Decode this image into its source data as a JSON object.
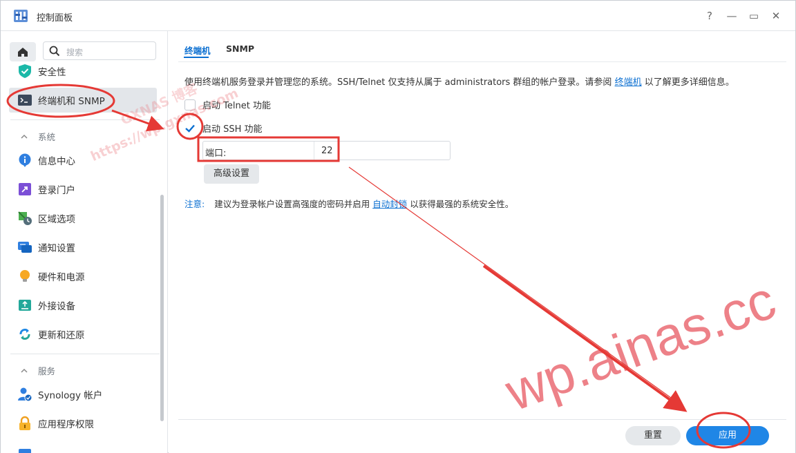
{
  "window": {
    "title": "控制面板",
    "help_glyph": "?",
    "minimize_glyph": "—",
    "maximize_glyph": "▭",
    "close_glyph": "✕"
  },
  "sidebar": {
    "search_placeholder": "搜索",
    "items_top": [
      {
        "label": "安全性",
        "icon": "shield-check-icon"
      },
      {
        "label": "终端机和 SNMP",
        "icon": "terminal-icon",
        "active": true
      }
    ],
    "section_system": "系统",
    "items_system": [
      {
        "label": "信息中心",
        "icon": "info-icon"
      },
      {
        "label": "登录门户",
        "icon": "login-portal-icon"
      },
      {
        "label": "区域选项",
        "icon": "region-options-icon"
      },
      {
        "label": "通知设置",
        "icon": "notification-icon"
      },
      {
        "label": "硬件和电源",
        "icon": "bulb-icon"
      },
      {
        "label": "外接设备",
        "icon": "external-device-icon"
      },
      {
        "label": "更新和还原",
        "icon": "update-restore-icon"
      }
    ],
    "section_services": "服务",
    "items_services": [
      {
        "label": "Synology 帐户",
        "icon": "synology-account-icon"
      },
      {
        "label": "应用程序权限",
        "icon": "lock-icon"
      }
    ]
  },
  "content": {
    "tabs": [
      {
        "label": "终端机",
        "active": true
      },
      {
        "label": "SNMP",
        "active": false
      }
    ],
    "description_prefix": "使用终端机服务登录并管理您的系统。SSH/Telnet 仅支持从属于 administrators 群组的帐户登录。请参阅",
    "description_link": "终端机",
    "description_suffix": "以了解更多详细信息。",
    "telnet_label": "启动 Telnet 功能",
    "telnet_checked": false,
    "ssh_label": "启动 SSH 功能",
    "ssh_checked": true,
    "port_label": "端口:",
    "port_value": "22",
    "advanced_button": "高级设置",
    "note_label": "注意:",
    "note_prefix": "建议为登录帐户设置高强度的密码并启用",
    "note_link": "自动封锁",
    "note_suffix": "以获得最强的系统安全性。",
    "reset_button": "重置",
    "apply_button": "应用"
  },
  "colors": {
    "accent": "#0b6fd1",
    "apply": "#1f86e6",
    "annotation": "#e53935"
  },
  "watermarks": {
    "main": "wp.ainas.cc",
    "small_1": "https://wp.gxnas.com",
    "small_2": "GXNAS 博客"
  }
}
